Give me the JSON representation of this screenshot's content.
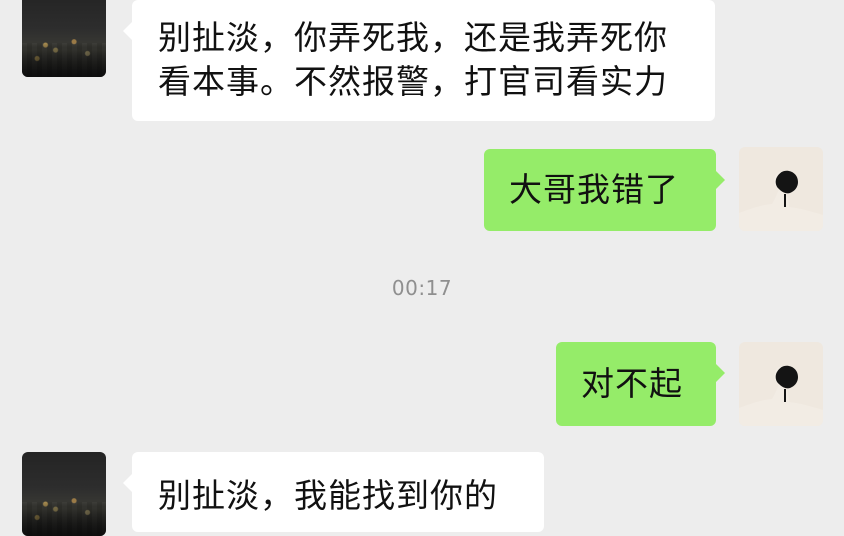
{
  "chat": {
    "timestamp": "00:17",
    "messages": [
      {
        "sender": "contact",
        "text": "别扯淡，你弄死我，还是我弄死你\n看本事。不然报警，打官司看实力"
      },
      {
        "sender": "me",
        "text": "大哥我错了"
      },
      {
        "sender": "me",
        "text": "对不起"
      },
      {
        "sender": "contact",
        "text": "别扯淡，我能找到你的"
      }
    ]
  },
  "icons": {
    "contact_avatar": "night-city-avatar-icon",
    "user_avatar": "portrait-avatar-icon"
  },
  "colors": {
    "background": "#ededed",
    "incoming_bubble": "#ffffff",
    "outgoing_bubble": "#95ec69",
    "timestamp": "#8f8f8f",
    "text": "#111111"
  }
}
